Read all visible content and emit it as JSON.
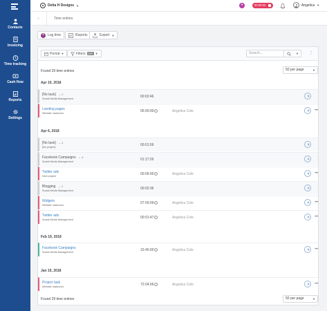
{
  "sidebar": {
    "items": [
      {
        "label": "Contacts",
        "icon": "contacts-icon"
      },
      {
        "label": "Invoicing",
        "icon": "invoice-icon"
      },
      {
        "label": "Time tracking",
        "icon": "clock-icon"
      },
      {
        "label": "Cash flow",
        "icon": "cash-flow-icon"
      },
      {
        "label": "Reports",
        "icon": "reports-icon"
      },
      {
        "label": "Settings",
        "icon": "gear-icon"
      }
    ]
  },
  "topbar": {
    "company": "Delta H Designs",
    "timer": "00:00:02",
    "user": "Angelica"
  },
  "breadcrumb": {
    "title": "Time entries"
  },
  "toolbar": {
    "log_time": "Log time",
    "reports": "Reports",
    "export": "Export"
  },
  "filters": {
    "period": "Period",
    "filters": "Filters",
    "off_badge": "OFF",
    "search_placeholder": "Search..."
  },
  "summary": {
    "found_top": "Found 29 time entries",
    "found_bottom": "Found 29 time entries",
    "per_page": "50 per page"
  },
  "groups": [
    {
      "date": "Apr 10, 2018",
      "entries": [
        {
          "title": "[No task]",
          "project": "Social Media Management",
          "count": "2",
          "time": "00:02:46",
          "user": "",
          "info": false
        },
        {
          "title": "Landing pages",
          "project": "Website makeover",
          "count": "",
          "time": "05:00:00",
          "user": "Angelica Cole",
          "info": true
        }
      ]
    },
    {
      "date": "Apr 6, 2018",
      "entries": [
        {
          "title": "[No task]",
          "project": "[No project]",
          "count": "4",
          "time": "00:01:59",
          "user": "",
          "info": false
        },
        {
          "title": "Facebook Campaigns",
          "project": "Social Media Management",
          "count": "4",
          "time": "01:17:26",
          "user": "",
          "info": false
        },
        {
          "title": "Twitter ads",
          "project": "New project",
          "count": "",
          "time": "00:06:00",
          "user": "Angelica Cole",
          "info": true
        },
        {
          "title": "Blogging",
          "project": "Social Media Management",
          "count": "2",
          "time": "00:02:36",
          "user": "",
          "info": false
        },
        {
          "title": "Widgets",
          "project": "Website makeover",
          "count": "",
          "time": "07:00:09",
          "user": "Angelica Cole",
          "info": true
        },
        {
          "title": "Twitter ads",
          "project": "Social Media Management",
          "count": "",
          "time": "00:01:47",
          "user": "Angelica Cole",
          "info": true
        }
      ]
    },
    {
      "date": "Feb 19, 2018",
      "entries": [
        {
          "title": "Facebook Campaigns",
          "project": "Social Media Management",
          "count": "",
          "time": "15:45:00",
          "user": "Angelica Cole",
          "info": true
        }
      ]
    },
    {
      "date": "Jan 15, 2018",
      "entries": [
        {
          "title": "Project task",
          "project": "Website makeover",
          "count": "",
          "time": "72:04:06",
          "user": "Angelica Cole",
          "info": true
        }
      ]
    }
  ]
}
